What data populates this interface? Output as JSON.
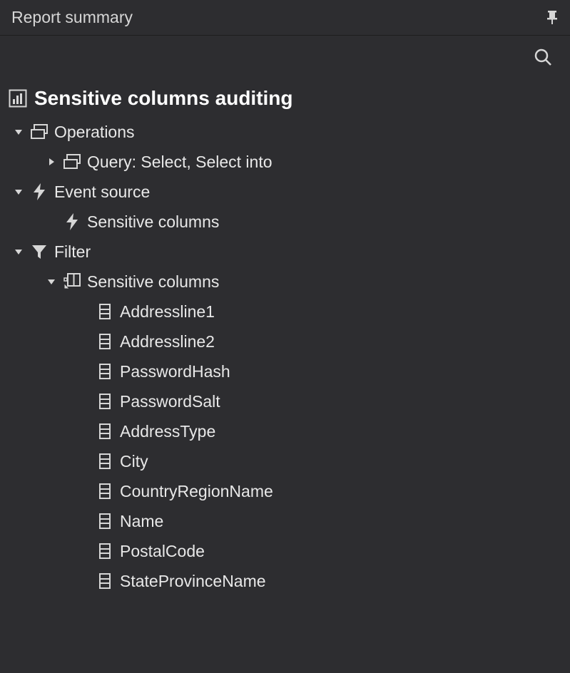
{
  "panel": {
    "title": "Report summary"
  },
  "root": {
    "title": "Sensitive columns auditing"
  },
  "group1": {
    "label": "Operations",
    "child_label": "Query: Select, Select into"
  },
  "group2": {
    "label": "Event source",
    "child_label": "Sensitive columns"
  },
  "group3": {
    "label": "Filter",
    "subgroup_label": "Sensitive columns",
    "columns": {
      "c0": "Addressline1",
      "c1": "Addressline2",
      "c2": "PasswordHash",
      "c3": "PasswordSalt",
      "c4": "AddressType",
      "c5": "City",
      "c6": "CountryRegionName",
      "c7": "Name",
      "c8": "PostalCode",
      "c9": "StateProvinceName"
    }
  }
}
